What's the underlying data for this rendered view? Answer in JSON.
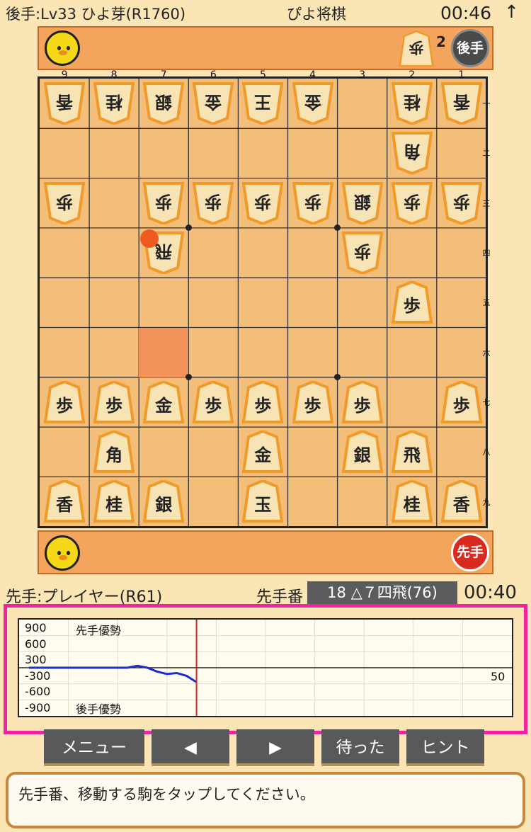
{
  "header": {
    "opponent_name": "後手:Lv33 ひよ芽(R1760)",
    "app_title": "ぴよ将棋",
    "opponent_timer": "00:46",
    "up_icon": "arrow-up-icon"
  },
  "gote_tray": {
    "captured": [
      {
        "label": "歩",
        "count": "2"
      }
    ],
    "badge": "後手"
  },
  "sente_tray": {
    "badge": "先手"
  },
  "board": {
    "file_labels": [
      "9",
      "8",
      "7",
      "6",
      "5",
      "4",
      "3",
      "2",
      "1"
    ],
    "rank_labels": [
      "一",
      "二",
      "三",
      "四",
      "五",
      "六",
      "七",
      "八",
      "九"
    ],
    "last_move_to": {
      "file": 7,
      "rank": 4
    },
    "last_move_from": {
      "file": 7,
      "rank": 6
    },
    "pieces": [
      {
        "file": 9,
        "rank": 1,
        "label": "香",
        "owner": "gote"
      },
      {
        "file": 8,
        "rank": 1,
        "label": "桂",
        "owner": "gote"
      },
      {
        "file": 7,
        "rank": 1,
        "label": "銀",
        "owner": "gote"
      },
      {
        "file": 6,
        "rank": 1,
        "label": "金",
        "owner": "gote"
      },
      {
        "file": 5,
        "rank": 1,
        "label": "王",
        "owner": "gote"
      },
      {
        "file": 4,
        "rank": 1,
        "label": "金",
        "owner": "gote"
      },
      {
        "file": 2,
        "rank": 1,
        "label": "桂",
        "owner": "gote"
      },
      {
        "file": 1,
        "rank": 1,
        "label": "香",
        "owner": "gote"
      },
      {
        "file": 2,
        "rank": 2,
        "label": "角",
        "owner": "gote"
      },
      {
        "file": 9,
        "rank": 3,
        "label": "歩",
        "owner": "gote"
      },
      {
        "file": 7,
        "rank": 3,
        "label": "歩",
        "owner": "gote"
      },
      {
        "file": 6,
        "rank": 3,
        "label": "歩",
        "owner": "gote"
      },
      {
        "file": 5,
        "rank": 3,
        "label": "歩",
        "owner": "gote"
      },
      {
        "file": 4,
        "rank": 3,
        "label": "歩",
        "owner": "gote"
      },
      {
        "file": 3,
        "rank": 3,
        "label": "銀",
        "owner": "gote"
      },
      {
        "file": 2,
        "rank": 3,
        "label": "歩",
        "owner": "gote"
      },
      {
        "file": 1,
        "rank": 3,
        "label": "歩",
        "owner": "gote"
      },
      {
        "file": 7,
        "rank": 4,
        "label": "飛",
        "owner": "gote"
      },
      {
        "file": 3,
        "rank": 4,
        "label": "歩",
        "owner": "gote"
      },
      {
        "file": 2,
        "rank": 5,
        "label": "歩",
        "owner": "sente"
      },
      {
        "file": 9,
        "rank": 7,
        "label": "歩",
        "owner": "sente"
      },
      {
        "file": 8,
        "rank": 7,
        "label": "歩",
        "owner": "sente"
      },
      {
        "file": 7,
        "rank": 7,
        "label": "金",
        "owner": "sente"
      },
      {
        "file": 6,
        "rank": 7,
        "label": "歩",
        "owner": "sente"
      },
      {
        "file": 5,
        "rank": 7,
        "label": "歩",
        "owner": "sente"
      },
      {
        "file": 4,
        "rank": 7,
        "label": "歩",
        "owner": "sente"
      },
      {
        "file": 3,
        "rank": 7,
        "label": "歩",
        "owner": "sente"
      },
      {
        "file": 1,
        "rank": 7,
        "label": "歩",
        "owner": "sente"
      },
      {
        "file": 8,
        "rank": 8,
        "label": "角",
        "owner": "sente"
      },
      {
        "file": 5,
        "rank": 8,
        "label": "金",
        "owner": "sente"
      },
      {
        "file": 3,
        "rank": 8,
        "label": "銀",
        "owner": "sente"
      },
      {
        "file": 2,
        "rank": 8,
        "label": "飛",
        "owner": "sente"
      },
      {
        "file": 9,
        "rank": 9,
        "label": "香",
        "owner": "sente"
      },
      {
        "file": 8,
        "rank": 9,
        "label": "桂",
        "owner": "sente"
      },
      {
        "file": 7,
        "rank": 9,
        "label": "銀",
        "owner": "sente"
      },
      {
        "file": 5,
        "rank": 9,
        "label": "玉",
        "owner": "sente"
      },
      {
        "file": 2,
        "rank": 9,
        "label": "桂",
        "owner": "sente"
      },
      {
        "file": 1,
        "rank": 9,
        "label": "香",
        "owner": "sente"
      }
    ]
  },
  "status_bar": {
    "player_name": "先手:プレイヤー(R61)",
    "turn": "先手番",
    "last_move": "18 △７四飛(76)",
    "player_timer": "00:40"
  },
  "chart_data": {
    "type": "line",
    "y_tick_labels": [
      "900",
      "600",
      "300",
      "-300",
      "-600",
      "-900"
    ],
    "ylim": [
      -1000,
      1000
    ],
    "xlim": [
      0,
      50
    ],
    "x_end_label": "50",
    "upper_annotation": "先手優勢",
    "lower_annotation": "後手優勢",
    "current_move": 18,
    "series": [
      {
        "values": [
          0,
          0,
          0,
          0,
          0,
          0,
          0,
          0,
          0,
          0,
          0,
          40,
          0,
          -80,
          -130,
          -110,
          -170,
          -300
        ]
      }
    ],
    "colors": {
      "line": "#1a2fd0",
      "cursor": "#cc2a2a"
    }
  },
  "buttons": {
    "menu": "メニュー",
    "prev": "◀",
    "next": "▶",
    "undo": "待った",
    "hint": "ヒント"
  },
  "message": "先手番、移動する駒をタップしてください。",
  "colors": {
    "accent_frame": "#f0249f",
    "tray": "#f3a55e",
    "board": "#f3be7a"
  }
}
